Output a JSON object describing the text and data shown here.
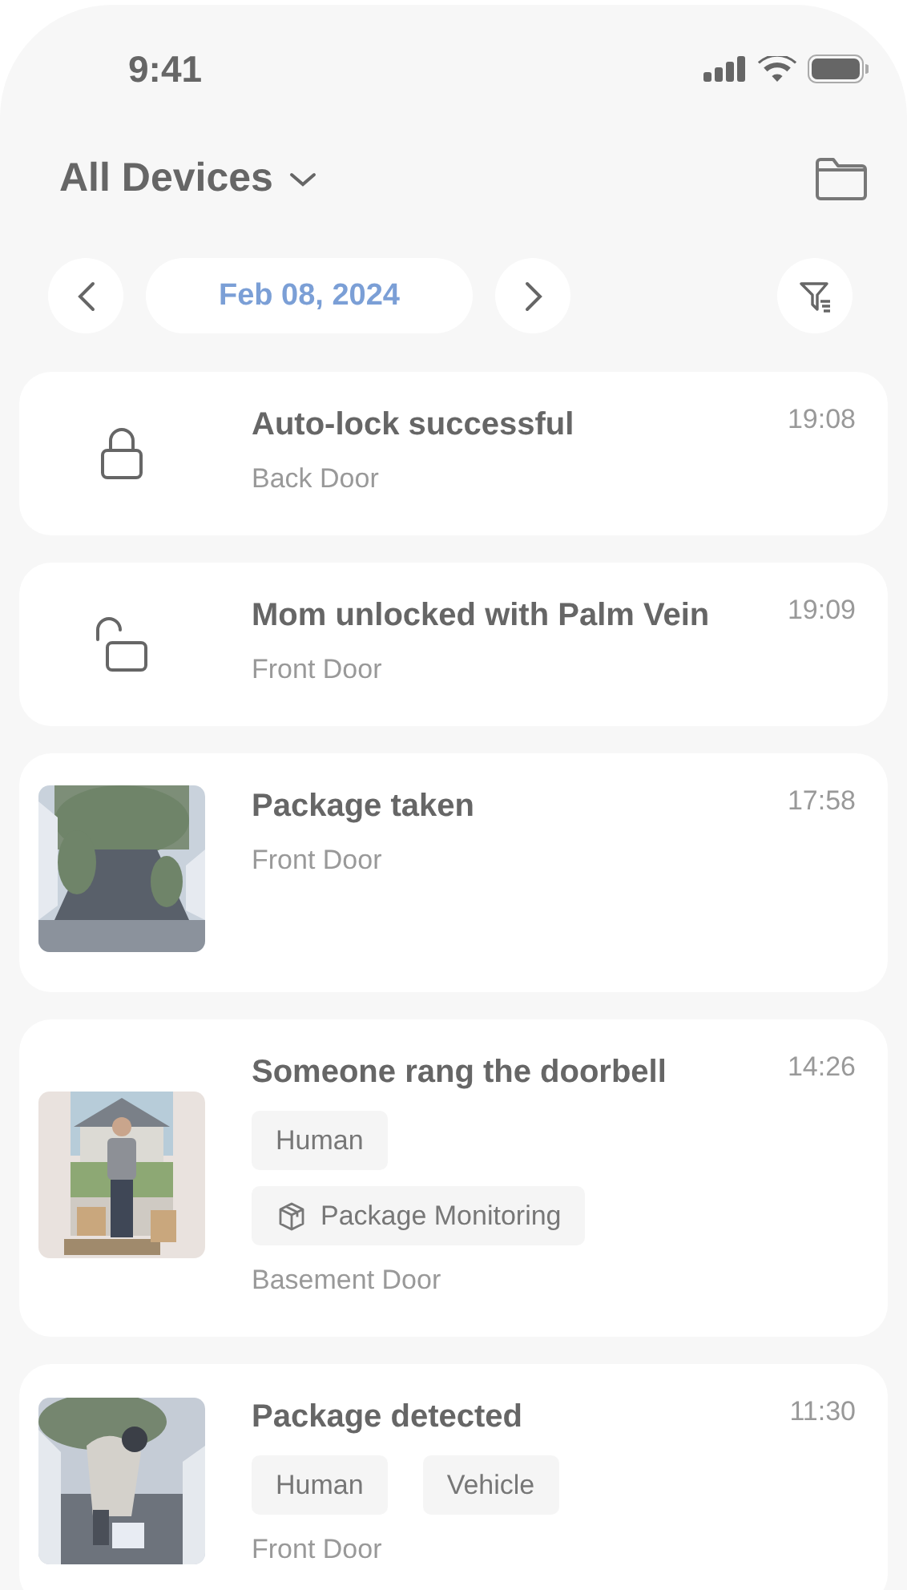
{
  "status_bar": {
    "time": "9:41"
  },
  "header": {
    "title": "All Devices"
  },
  "date_bar": {
    "date": "Feb 08, 2024"
  },
  "events": [
    {
      "kind": "lock",
      "title": "Auto-lock successful",
      "device": "Back Door",
      "time": "19:08"
    },
    {
      "kind": "unlock",
      "title": "Mom unlocked with Palm Vein",
      "device": "Front Door",
      "time": "19:09"
    },
    {
      "kind": "picture",
      "title": "Package taken",
      "device": "Front Door",
      "time": "17:58"
    },
    {
      "kind": "picture",
      "title": "Someone rang the doorbell",
      "tags": [
        {
          "label": "Human"
        },
        {
          "label": "Package Monitoring",
          "kind": "package"
        }
      ],
      "device": "Basement Door",
      "time": "14:26"
    },
    {
      "kind": "picture",
      "title": "Package detected",
      "tags": [
        {
          "label": "Human"
        },
        {
          "label": "Vehicle"
        }
      ],
      "device": "Front Door",
      "time": "11:30"
    }
  ]
}
